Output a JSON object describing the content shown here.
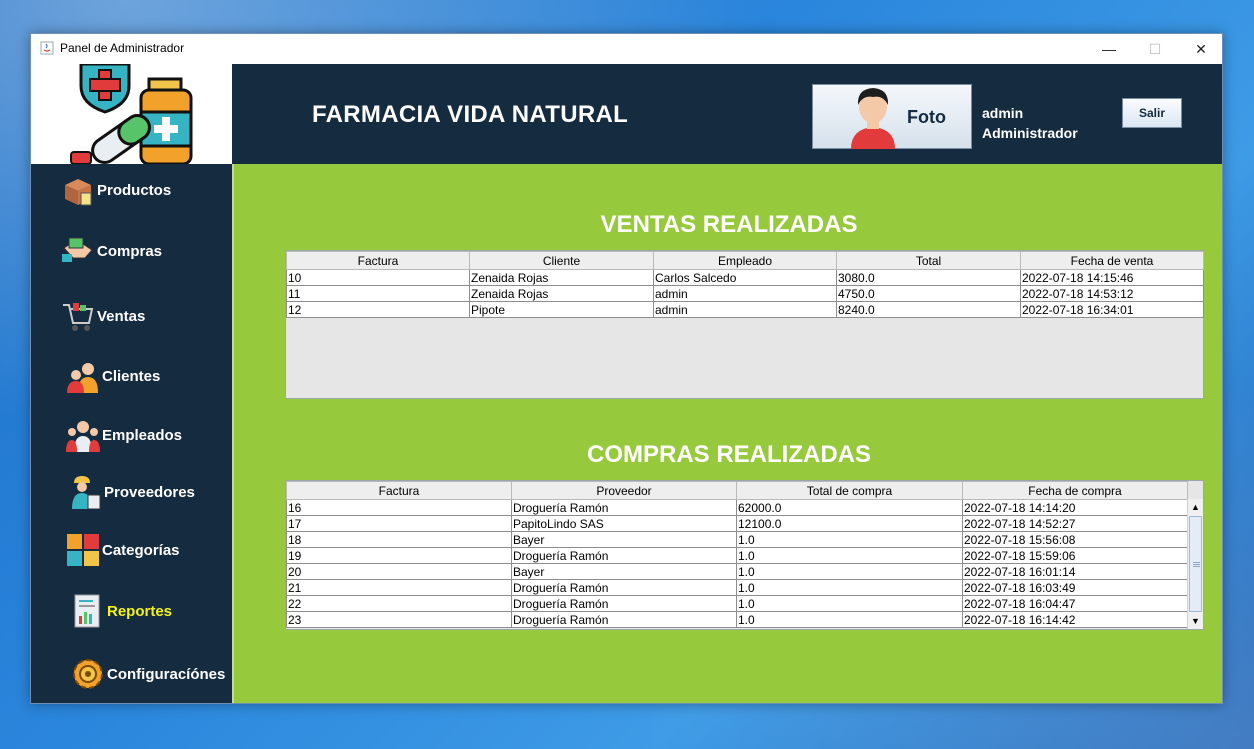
{
  "window": {
    "title": "Panel de Administrador",
    "min_glyph": "—",
    "max_glyph": "☐",
    "close_glyph": "✕"
  },
  "header": {
    "store_name": "FARMACIA VIDA NATURAL",
    "photo_label": "Foto",
    "user_name": "admin",
    "user_role": "Administrador",
    "logout_label": "Salir"
  },
  "sidebar": {
    "items": [
      {
        "label": "Productos",
        "icon": "box-icon"
      },
      {
        "label": "Compras",
        "icon": "handshake-icon"
      },
      {
        "label": "Ventas",
        "icon": "cart-icon"
      },
      {
        "label": "Clientes",
        "icon": "customers-icon"
      },
      {
        "label": "Empleados",
        "icon": "employees-icon"
      },
      {
        "label": "Proveedores",
        "icon": "supplier-icon"
      },
      {
        "label": "Categorías",
        "icon": "categories-icon"
      },
      {
        "label": "Reportes",
        "icon": "report-icon"
      },
      {
        "label": "Configuracíónes",
        "icon": "gear-icon"
      }
    ],
    "active_color": "#f3f21d"
  },
  "sales": {
    "title": "VENTAS REALIZADAS",
    "columns": [
      "Factura",
      "Cliente",
      "Empleado",
      "Total",
      "Fecha de venta"
    ],
    "rows": [
      [
        "10",
        "Zenaida Rojas",
        "Carlos Salcedo",
        "3080.0",
        "2022-07-18 14:15:46"
      ],
      [
        "11",
        "Zenaida Rojas",
        "admin",
        "4750.0",
        "2022-07-18 14:53:12"
      ],
      [
        "12",
        "Pipote",
        "admin",
        "8240.0",
        "2022-07-18 16:34:01"
      ]
    ]
  },
  "purchases": {
    "title": "COMPRAS REALIZADAS",
    "columns": [
      "Factura",
      "Proveedor",
      "Total de compra",
      "Fecha de compra"
    ],
    "rows": [
      [
        "16",
        "Droguería Ramón",
        "62000.0",
        "2022-07-18 14:14:20"
      ],
      [
        "17",
        "PapitoLindo SAS",
        "12100.0",
        "2022-07-18 14:52:27"
      ],
      [
        "18",
        "Bayer",
        "1.0",
        "2022-07-18 15:56:08"
      ],
      [
        "19",
        "Droguería Ramón",
        "1.0",
        "2022-07-18 15:59:06"
      ],
      [
        "20",
        "Bayer",
        "1.0",
        "2022-07-18 16:01:14"
      ],
      [
        "21",
        "Droguería Ramón",
        "1.0",
        "2022-07-18 16:03:49"
      ],
      [
        "22",
        "Droguería Ramón",
        "1.0",
        "2022-07-18 16:04:47"
      ],
      [
        "23",
        "Droguería Ramón",
        "1.0",
        "2022-07-18 16:14:42"
      ]
    ],
    "scroll_up_glyph": "▲",
    "scroll_down_glyph": "▼"
  },
  "colors": {
    "header_bg": "#152b3f",
    "main_bg": "#97c93c"
  }
}
